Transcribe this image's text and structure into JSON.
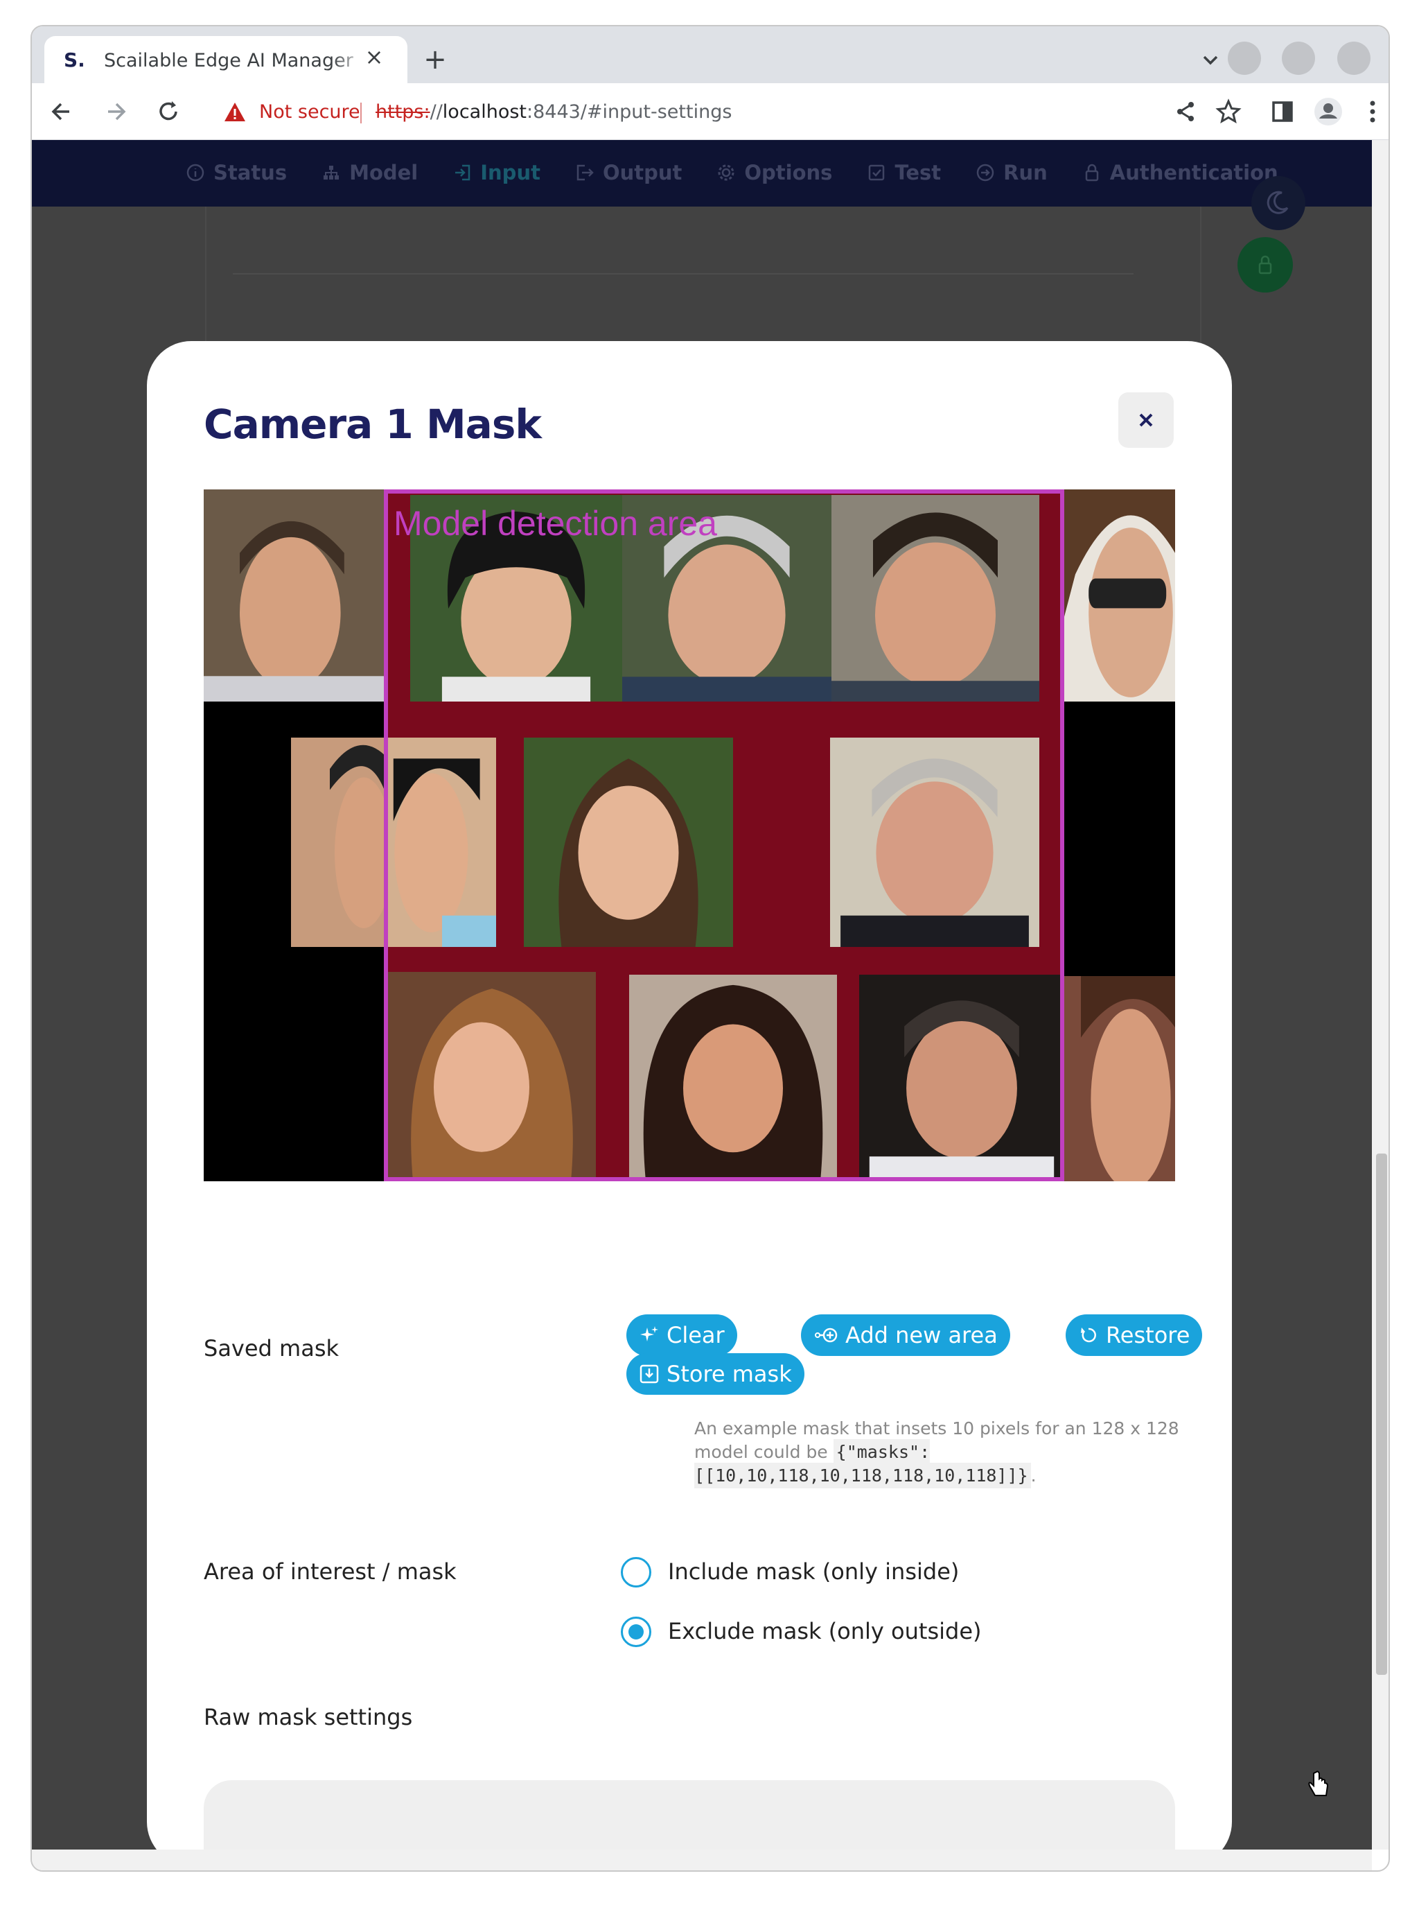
{
  "browser": {
    "tab_favicon": "S.",
    "tab_title": "Scailable Edge AI Manager",
    "tab_close": "×",
    "new_tab": "+",
    "not_secure": "Not secure",
    "url_scheme": "https:",
    "url_slashes": "//",
    "url_host": "localhost",
    "url_rest": ":8443/#input-settings"
  },
  "app_nav": {
    "items": [
      {
        "label": "Status",
        "icon": "info-icon"
      },
      {
        "label": "Model",
        "icon": "sitemap-icon"
      },
      {
        "label": "Input",
        "icon": "sign-in-icon"
      },
      {
        "label": "Output",
        "icon": "sign-out-icon"
      },
      {
        "label": "Options",
        "icon": "gear-icon"
      },
      {
        "label": "Test",
        "icon": "checkbox-icon"
      },
      {
        "label": "Run",
        "icon": "play-circle-icon"
      },
      {
        "label": "Authentication",
        "icon": "lock-icon"
      }
    ],
    "active": "Input"
  },
  "modal": {
    "title": "Camera 1 Mask",
    "close": "×",
    "detection_label": "Model detection area",
    "saved_mask_label": "Saved mask",
    "buttons": {
      "clear": "Clear",
      "add_area": "Add new area",
      "restore": "Restore",
      "store": "Store mask"
    },
    "hint_text": "An example mask that insets 10 pixels for an 128 x 128 model could be",
    "hint_code": "{\"masks\":[[10,10,118,10,118,118,10,118]]}",
    "hint_end": ".",
    "area_label": "Area of interest / mask",
    "radio_options": [
      {
        "label": "Include mask (only inside)",
        "checked": false
      },
      {
        "label": "Exclude mask (only outside)",
        "checked": true
      }
    ],
    "raw_label": "Raw mask settings",
    "raw_value": ""
  },
  "colors": {
    "accent": "#1aa3dc",
    "title": "#1d2060",
    "nav_bg": "#0e1333",
    "mask_red": "#7a0a1d",
    "detection_border": "#c040c0"
  }
}
